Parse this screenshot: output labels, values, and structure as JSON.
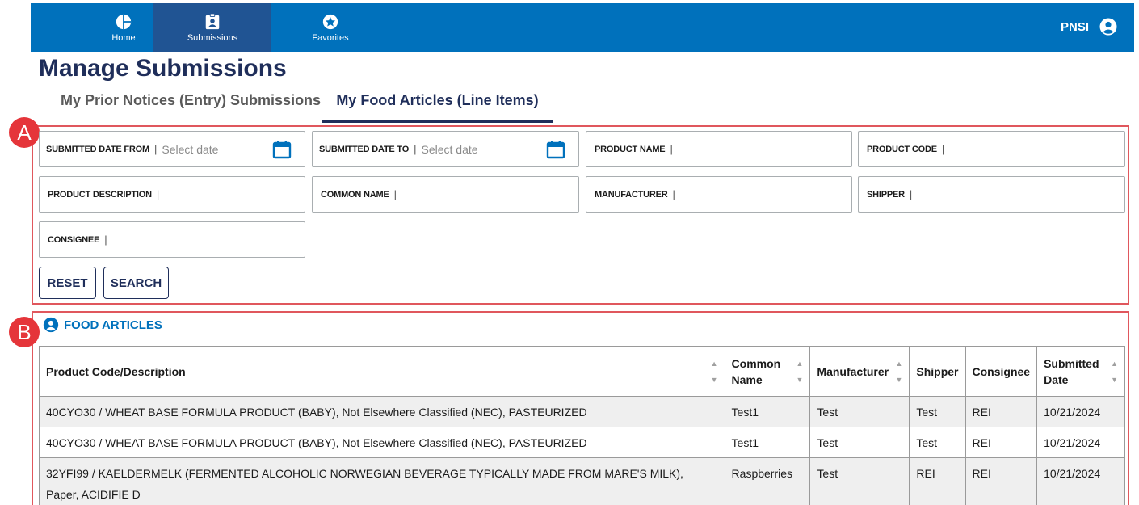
{
  "nav": {
    "items": [
      {
        "label": "Home",
        "icon": "pie-chart-icon"
      },
      {
        "label": "Submissions",
        "icon": "id-badge-icon"
      },
      {
        "label": "Favorites",
        "icon": "star-circle-icon"
      }
    ],
    "user": "PNSI"
  },
  "page": {
    "title": "Manage Submissions",
    "tabs": [
      {
        "label": "My Prior Notices (Entry) Submissions"
      },
      {
        "label": "My Food Articles (Line Items)"
      }
    ]
  },
  "callouts": {
    "a": "A",
    "b": "B"
  },
  "filters": {
    "submitted_from": {
      "label": "SUBMITTED DATE FROM",
      "placeholder": "Select date"
    },
    "submitted_to": {
      "label": "SUBMITTED DATE TO",
      "placeholder": "Select date"
    },
    "product_name": {
      "label": "PRODUCT NAME"
    },
    "product_code": {
      "label": "PRODUCT CODE"
    },
    "product_description": {
      "label": "PRODUCT DESCRIPTION"
    },
    "common_name": {
      "label": "COMMON NAME"
    },
    "manufacturer": {
      "label": "MANUFACTURER"
    },
    "shipper": {
      "label": "SHIPPER"
    },
    "consignee": {
      "label": "CONSIGNEE"
    },
    "separator": "|",
    "reset_label": "RESET",
    "search_label": "SEARCH"
  },
  "food_articles": {
    "title": "FOOD ARTICLES",
    "columns": [
      {
        "label": "Product Code/Description"
      },
      {
        "label": "Common Name"
      },
      {
        "label": "Manufacturer"
      },
      {
        "label": "Shipper"
      },
      {
        "label": "Consignee"
      },
      {
        "label": "Submitted Date"
      }
    ],
    "rows": [
      {
        "product": "40CYO30 / WHEAT BASE FORMULA PRODUCT (BABY), Not Elsewhere Classified (NEC), PASTEURIZED",
        "common_name": "Test1",
        "manufacturer": "Test",
        "shipper": "Test",
        "consignee": "REI",
        "submitted": "10/21/2024"
      },
      {
        "product": "40CYO30 / WHEAT BASE FORMULA PRODUCT (BABY), Not Elsewhere Classified (NEC), PASTEURIZED",
        "common_name": "Test1",
        "manufacturer": "Test",
        "shipper": "Test",
        "consignee": "REI",
        "submitted": "10/21/2024"
      },
      {
        "product": "32YFI99 / KAELDERMELK (FERMENTED ALCOHOLIC NORWEGIAN BEVERAGE TYPICALLY MADE FROM MARE'S MILK), Paper, ACIDIFIE D",
        "common_name": "Raspberries",
        "manufacturer": "Test",
        "shipper": "REI",
        "consignee": "REI",
        "submitted": "10/21/2024"
      }
    ]
  },
  "colors": {
    "nav_bg": "#0071bc",
    "nav_active": "#205493",
    "title": "#1f2e5a",
    "callout": "#e0575d",
    "link": "#0071bc"
  }
}
